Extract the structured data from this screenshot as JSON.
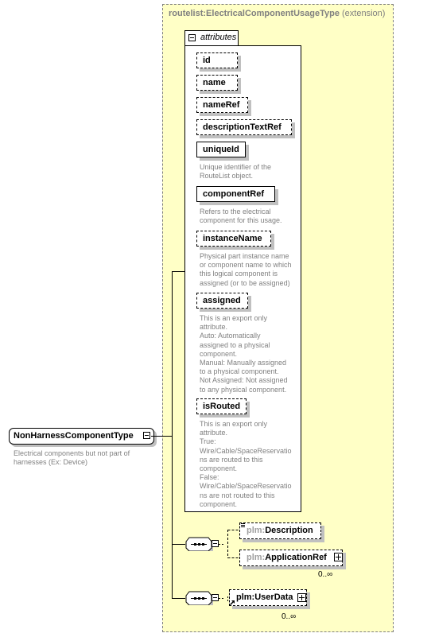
{
  "extension": {
    "base": "routelist:ElectricalComponentUsageType",
    "kind": "(extension)"
  },
  "attributes_group": {
    "label": "attributes",
    "toggle": "collapse-toggle"
  },
  "attributes": [
    {
      "name": "id",
      "use": "optional",
      "description": ""
    },
    {
      "name": "name",
      "use": "optional",
      "description": ""
    },
    {
      "name": "nameRef",
      "use": "optional",
      "description": ""
    },
    {
      "name": "descriptionTextRef",
      "use": "optional",
      "description": ""
    },
    {
      "name": "uniqueId",
      "use": "required",
      "description": "Unique identifier of the\nRouteList object."
    },
    {
      "name": "componentRef",
      "use": "required",
      "description": "Refers to the electrical\ncomponent for this usage."
    },
    {
      "name": "instanceName",
      "use": "optional",
      "description": "Physical part instance name\nor component name to which\nthis logical component is\nassigned (or to be assigned)"
    },
    {
      "name": "assigned",
      "use": "optional",
      "description": "This is an export only\nattribute.\nAuto:  Automatically\nassigned to a physical\ncomponent.\nManual: Manually assigned\nto a physical component.\nNot Assigned: Not assigned\nto any physical component."
    },
    {
      "name": "isRouted",
      "use": "optional",
      "description": "This is an export only\nattribute.\nTrue:\nWire/Cable/SpaceReservatio\nns are routed to this\ncomponent.\nFalse:\nWire/Cable/SpaceReservatio\nns are not routed to this\ncomponent."
    }
  ],
  "root_element": {
    "name": "NonHarnessComponentType",
    "description": "Electrical components but not part of\nharnesses (Ex: Device)"
  },
  "sequences": [
    {
      "compositor": "sequence",
      "elements": [
        {
          "prefix": "plm:",
          "name": "Description",
          "occurrence": "",
          "expandable": false
        },
        {
          "prefix": "plm:",
          "name": "ApplicationRef",
          "occurrence": "0..∞",
          "expandable": true
        }
      ]
    },
    {
      "compositor": "sequence",
      "elements": [
        {
          "prefix": "plm:",
          "name": "UserData",
          "occurrence": "0..∞",
          "expandable": true
        }
      ]
    }
  ]
}
